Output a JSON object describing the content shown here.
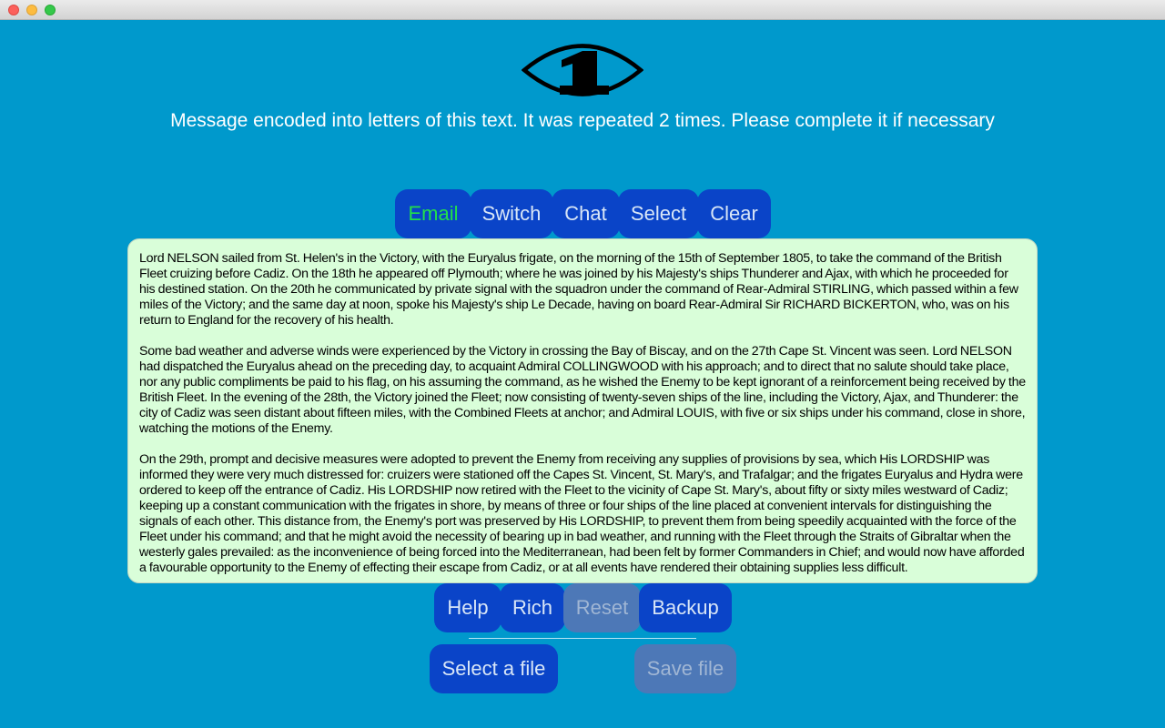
{
  "app": {
    "headline": "Message encoded into letters of this text. It was repeated 2 times. Please complete it if necessary",
    "logo_icon": "eye-with-number-one-logo"
  },
  "top_toolbar": {
    "email": "Email",
    "switch": "Switch",
    "chat": "Chat",
    "select": "Select",
    "clear": "Clear"
  },
  "content": {
    "paragraphs": [
      "Lord NELSON sailed from St. Helen's in the Victory, with the Euryalus frigate, on the morning of the 15th of September 1805, to take the command of the British Fleet cruizing before Cadiz. On the 18th he appeared off Plymouth; where he was joined by his Majesty's ships Thunderer and Ajax, with which he proceeded for his destined station. On the 20th he communicated by private signal with the squadron under the command of Rear-Admiral STIRLING, which passed within a few miles of the Victory; and the same day at noon, spoke his Majesty's ship Le Decade, having on board Rear-Admiral Sir RICHARD BICKERTON, who, was on his return to England for the recovery of his health.",
      "Some bad weather and adverse winds were experienced by the Victory in crossing the Bay of Biscay, and on the 27th Cape St. Vincent was seen. Lord NELSON had dispatched the Euryalus ahead on the preceding day, to acquaint Admiral COLLINGWOOD with his approach; and to direct that no salute should take place, nor any public compliments be paid to his flag, on his assuming the command, as he wished the Enemy to be kept ignorant of a reinforcement being received by the British Fleet. In the evening of the 28th, the Victory joined the Fleet; now consisting of twenty-seven ships of the line, including the Victory, Ajax, and Thunderer: the city of Cadiz was seen distant about fifteen miles, with the Combined Fleets at anchor; and Admiral LOUIS, with five or six ships under his command, close in shore, watching the motions of the Enemy.",
      "On the 29th, prompt and decisive measures were adopted to prevent the Enemy from receiving any supplies of provisions by sea, which His LORDSHIP was informed they were very much distressed for: cruizers were stationed off the Capes St. Vincent, St. Mary's, and Trafalgar; and the frigates Euryalus and Hydra were ordered to keep off the entrance of Cadiz. His LORDSHIP now retired with the Fleet to the vicinity of Cape St. Mary's, about fifty or sixty miles westward of Cadiz; keeping up a constant communication with the frigates in shore, by means of three or four ships of the line placed at convenient intervals for distinguishing the signals of each other. This distance from, the Enemy's port was preserved by His LORDSHIP, to prevent them from being speedily acquainted with the force of the Fleet under his command; and that he might avoid the necessity of bearing up in bad weather, and running with the Fleet through the Straits of Gibraltar when the westerly gales prevailed: as the inconvenience of being forced into the Mediterranean, had been felt by former Commanders in Chief; and would now have afforded a favourable opportunity to the Enemy of effecting their escape from Cadiz, or at all events have rendered their obtaining supplies less difficult."
    ]
  },
  "bottom_toolbar": {
    "help": "Help",
    "rich": "Rich",
    "reset": "Reset",
    "backup": "Backup"
  },
  "file_actions": {
    "select_file": "Select a file",
    "save_file": "Save file"
  },
  "colors": {
    "background": "#0099cc",
    "button": "#0a44c8",
    "button_disabled": "#4d78b7",
    "active_label": "#22e04a",
    "text_panel": "#d9fed9"
  }
}
